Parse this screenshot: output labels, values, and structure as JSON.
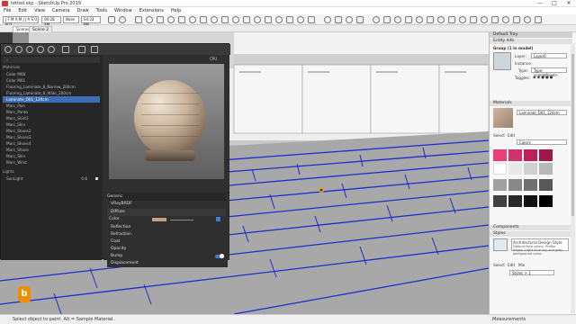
{
  "window": {
    "title": "tetted.skp - SketchUp Pro 2019",
    "controls": [
      "—",
      "□",
      "✕"
    ]
  },
  "menu": [
    "File",
    "Edit",
    "View",
    "Camera",
    "Draw",
    "Tools",
    "Window",
    "Extensions",
    "Help"
  ],
  "toolbar": {
    "field1": "J F M A M J J A S O N D",
    "time1": "06:28 AM",
    "time2": "Noon",
    "time3": "04:24 PM"
  },
  "scenes": [
    "Scene 1",
    "Scene 2"
  ],
  "material_editor": {
    "header_left": "Materials",
    "materials": [
      "Color M08",
      "Color M01",
      "Flooring_Laminate_8_Narrow_200cm",
      "Flooring_Laminate_8_Wide_200cm",
      "Laminate_D01_120cm",
      "Marc_Pain",
      "Marc_Panto",
      "Marc_Shirt1",
      "Marc_Skin",
      "Marc_Shoes2",
      "Marc_Shoes3",
      "Marc_Shoes4",
      "Marc_Shoes",
      "Marc_Skin",
      "Marc_Wrist"
    ],
    "selected_index": 4,
    "lights_header": "Lights",
    "light_name": "SunLight",
    "light_value": "0.6",
    "preview_label": "CPU",
    "generic": "Generic",
    "brdf": "VRayBRDF",
    "diffuse": "Diffuse",
    "color_label": "Color",
    "sections": [
      "Reflection",
      "Refraction",
      "Coat",
      "Opacity",
      "Bump",
      "Bump",
      "Displacement"
    ]
  },
  "viewport": {
    "brand_glyph": "b"
  },
  "tray": {
    "title": "Default Tray",
    "entity_info": "Entity Info",
    "entity_desc": "Group (1 in model)",
    "layer_label": "Layer:",
    "layer_value": "Layer0",
    "instance_label": "Instance:",
    "type_label": "Type:",
    "type_value": "Type: <undefined>",
    "toggles_label": "Toggles:",
    "materials": "Materials",
    "mat_name": "Laminate_D01_120cm",
    "select_tab": "Select",
    "edit_tab": "Edit",
    "colors_value": "Colors",
    "swatch_colors": [
      "#e83e7a",
      "#d4306a",
      "#c0205a",
      "#a0184a",
      "#ffffff",
      "#e8e8e8",
      "#d0d0d0",
      "#b8b8b8",
      "#a0a0a0",
      "#888888",
      "#707070",
      "#585858",
      "#404040",
      "#282828",
      "#101010",
      "#000000"
    ],
    "components": "Components",
    "styles": "Styles",
    "style_name": "Architectural Design Style",
    "style_desc": "Default face colors. Profile edges. Light blue sky and grey background color.",
    "styles_tabs": [
      "Select",
      "Edit",
      "Mix"
    ],
    "styles_dropdown": "Styles > 1"
  },
  "status": {
    "message": "Select object to paint. Alt = Sample Material.",
    "measurements": "Measurements"
  }
}
